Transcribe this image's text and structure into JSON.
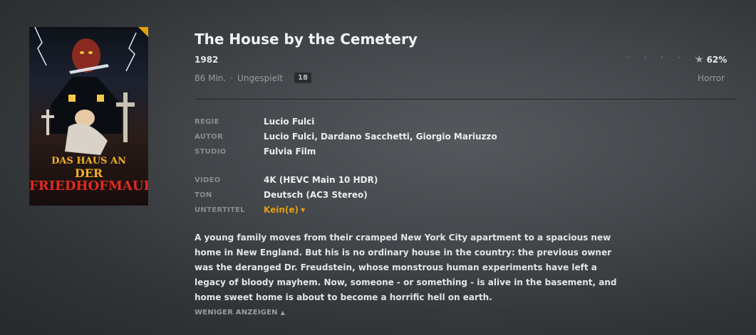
{
  "poster": {
    "text_line1": "DAS HAUS AN",
    "text_line2": "DER",
    "text_line3": "FRIEDHOFMAUER"
  },
  "movie": {
    "title": "The House by the Cemetery",
    "year": "1982",
    "runtime": "86 Min.",
    "separator": "·",
    "play_status": "Ungespielt",
    "age_rating": "18",
    "rating_dots": "· · · · ·",
    "rating": "62%",
    "genre": "Horror"
  },
  "credits": [
    {
      "label": "REGIE",
      "value": "Lucio Fulci"
    },
    {
      "label": "AUTOR",
      "value": "Lucio Fulci, Dardano Sacchetti, Giorgio Mariuzzo"
    },
    {
      "label": "STUDIO",
      "value": "Fulvia Film"
    }
  ],
  "media": [
    {
      "label": "VIDEO",
      "value": "4K (HEVC Main 10 HDR)"
    },
    {
      "label": "TON",
      "value": "Deutsch (AC3 Stereo)"
    },
    {
      "label": "UNTERTITEL",
      "value": "Kein(e)"
    }
  ],
  "summary": "A young family moves from their cramped New York City apartment to a spacious new home in New England. But his is no ordinary house in the country: the previous owner was the deranged Dr. Freudstein, whose monstrous human experiments have left a legacy of bloody mayhem. Now, someone - or something - is alive in the basement, and home sweet home is about to become a horrific hell on earth.",
  "show_less_label": "WENIGER ANZEIGEN",
  "colors": {
    "accent": "#e5a00d"
  },
  "icons": {
    "star": "star-icon",
    "subtitle_caret": "caret-down-icon",
    "less_caret": "caret-up-icon"
  }
}
